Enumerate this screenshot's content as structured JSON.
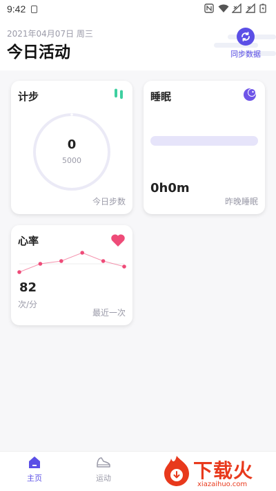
{
  "status_bar": {
    "time": "9:42"
  },
  "header": {
    "date": "2021年04月07日 周三",
    "title": "今日活动",
    "sync_label": "同步数据"
  },
  "cards": {
    "steps": {
      "title": "计步",
      "value": "0",
      "goal": "5000",
      "footer": "今日步数",
      "progress": 0
    },
    "sleep": {
      "title": "睡眠",
      "value": "0h0m",
      "footer": "昨晚睡眠"
    },
    "heart": {
      "title": "心率",
      "value": "82",
      "unit": "次/分",
      "footer": "最近一次",
      "trend": [
        82,
        88,
        90,
        96,
        90,
        86
      ]
    }
  },
  "colors": {
    "accent": "#5b4fe6",
    "steps_icon": "#3ecfa0",
    "sleep_icon": "#6f55e8",
    "heart": "#ee4b78",
    "ring": "#ebeaf6",
    "sleep_bar": "#e6e4fa"
  },
  "tabs": [
    {
      "label": "主页",
      "icon": "home-icon",
      "active": true
    },
    {
      "label": "运动",
      "icon": "sneaker-icon",
      "active": false
    }
  ],
  "watermark": {
    "text": "下载火",
    "sub": "xiazaihuo.com"
  }
}
